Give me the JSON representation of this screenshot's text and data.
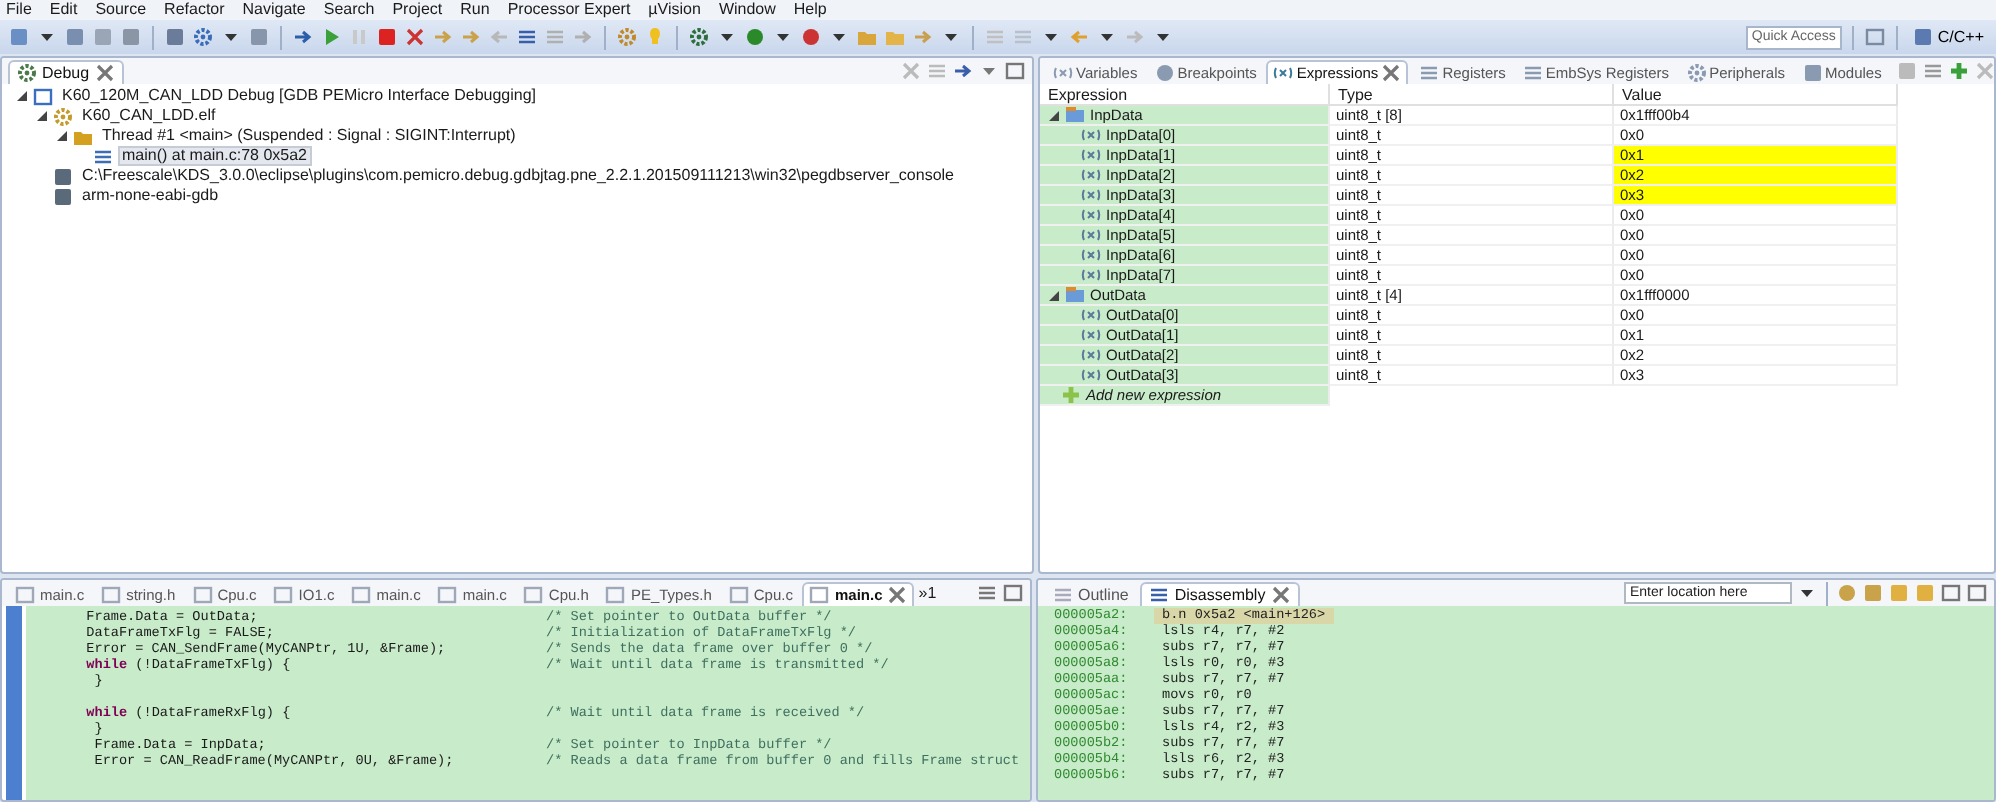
{
  "menu": [
    "File",
    "Edit",
    "Source",
    "Refactor",
    "Navigate",
    "Search",
    "Project",
    "Run",
    "Processor Expert",
    "µVision",
    "Window",
    "Help"
  ],
  "toolbar": {
    "quick_access": {
      "placeholder": "Quick Access"
    },
    "perspective": "C/C++"
  },
  "debug_view": {
    "tab": "Debug",
    "tree": [
      {
        "kind": "launch",
        "label": "K60_120M_CAN_LDD Debug [GDB PEMicro Interface Debugging]",
        "expanded": true,
        "selected": false,
        "children": [
          {
            "kind": "elf",
            "label": "K60_CAN_LDD.elf",
            "expanded": true,
            "selected": false,
            "children": [
              {
                "kind": "thread",
                "label": "Thread #1 <main> (Suspended : Signal : SIGINT:Interrupt)",
                "expanded": true,
                "selected": false,
                "children": [
                  {
                    "kind": "frame",
                    "label": "main() at main.c:78 0x5a2",
                    "selected": true
                  }
                ]
              }
            ]
          },
          {
            "kind": "process",
            "label": "C:\\Freescale\\KDS_3.0.0\\eclipse\\plugins\\com.pemicro.debug.gdbjtag.pne_2.2.1.201509111213\\win32\\pegdbserver_console",
            "selected": false
          },
          {
            "kind": "process",
            "label": "arm-none-eabi-gdb",
            "selected": false
          }
        ]
      }
    ]
  },
  "expressions_view": {
    "tabs": [
      {
        "label": "Variables",
        "selected": false
      },
      {
        "label": "Breakpoints",
        "selected": false
      },
      {
        "label": "Expressions",
        "selected": true
      },
      {
        "label": "Registers",
        "selected": false
      },
      {
        "label": "EmbSys Registers",
        "selected": false
      },
      {
        "label": "Peripherals",
        "selected": false
      },
      {
        "label": "Modules",
        "selected": false
      }
    ],
    "columns": [
      "Expression",
      "Type",
      "Value"
    ],
    "rows": [
      {
        "name": "InpData",
        "type": "uint8_t [8]",
        "value": "0x1fff00b4",
        "changed": false,
        "expanded": true,
        "children": [
          {
            "name": "InpData[0]",
            "type": "uint8_t",
            "value": "0x0",
            "changed": false
          },
          {
            "name": "InpData[1]",
            "type": "uint8_t",
            "value": "0x1",
            "changed": true
          },
          {
            "name": "InpData[2]",
            "type": "uint8_t",
            "value": "0x2",
            "changed": true
          },
          {
            "name": "InpData[3]",
            "type": "uint8_t",
            "value": "0x3",
            "changed": true
          },
          {
            "name": "InpData[4]",
            "type": "uint8_t",
            "value": "0x0",
            "changed": false
          },
          {
            "name": "InpData[5]",
            "type": "uint8_t",
            "value": "0x0",
            "changed": false
          },
          {
            "name": "InpData[6]",
            "type": "uint8_t",
            "value": "0x0",
            "changed": false
          },
          {
            "name": "InpData[7]",
            "type": "uint8_t",
            "value": "0x0",
            "changed": false
          }
        ]
      },
      {
        "name": "OutData",
        "type": "uint8_t [4]",
        "value": "0x1fff0000",
        "changed": false,
        "expanded": true,
        "children": [
          {
            "name": "OutData[0]",
            "type": "uint8_t",
            "value": "0x0",
            "changed": false
          },
          {
            "name": "OutData[1]",
            "type": "uint8_t",
            "value": "0x1",
            "changed": false
          },
          {
            "name": "OutData[2]",
            "type": "uint8_t",
            "value": "0x2",
            "changed": false
          },
          {
            "name": "OutData[3]",
            "type": "uint8_t",
            "value": "0x3",
            "changed": false
          }
        ]
      }
    ],
    "add_expression": "Add new expression"
  },
  "editor": {
    "tabs": [
      {
        "label": "main.c",
        "selected": false
      },
      {
        "label": "string.h",
        "selected": false
      },
      {
        "label": "Cpu.c",
        "selected": false
      },
      {
        "label": "IO1.c",
        "selected": false
      },
      {
        "label": "main.c",
        "selected": false
      },
      {
        "label": "main.c",
        "selected": false
      },
      {
        "label": "Cpu.h",
        "selected": false
      },
      {
        "label": "PE_Types.h",
        "selected": false
      },
      {
        "label": "Cpu.c",
        "selected": false
      },
      {
        "label": "main.c",
        "selected": true
      }
    ],
    "overflow": "»1",
    "lines": [
      {
        "kind": "code",
        "code": "  Frame.Data = OutData;",
        "comment": "/* Set pointer to OutData buffer */"
      },
      {
        "kind": "code",
        "code": "  DataFrameTxFlg = FALSE;",
        "comment": "/* Initialization of DataFrameTxFlg */"
      },
      {
        "kind": "code",
        "code": "  Error = CAN_SendFrame(MyCANPtr, 1U, &Frame);",
        "comment": "/* Sends the data frame over buffer 0 */"
      },
      {
        "kind": "code",
        "code": "  **while** (!DataFrameTxFlg) {",
        "comment": "/* Wait until data frame is transmitted */"
      },
      {
        "kind": "code",
        "code": "   }"
      },
      {
        "kind": "blank"
      },
      {
        "kind": "code",
        "code": "  **while** (!DataFrameRxFlg) {",
        "comment": "/* Wait until data frame is received */"
      },
      {
        "kind": "code",
        "code": "   }"
      },
      {
        "kind": "code",
        "code": "   Frame.Data = InpData;",
        "comment": "/* Set pointer to InpData buffer */"
      },
      {
        "kind": "code",
        "code": "   Error = CAN_ReadFrame(MyCANPtr, 0U, &Frame);",
        "comment": "/* Reads a data frame from buffer 0 and fills Frame struct"
      }
    ]
  },
  "disassembly": {
    "tabs": [
      {
        "label": "Outline",
        "selected": false
      },
      {
        "label": "Disassembly",
        "selected": true
      }
    ],
    "location": {
      "placeholder": "Enter location here"
    },
    "lines": [
      {
        "address": "000005a2:",
        "instruction": "b.n 0x5a2 <main+126>",
        "current": true
      },
      {
        "address": "000005a4:",
        "instruction": "lsls r4, r7, #2",
        "current": false
      },
      {
        "address": "000005a6:",
        "instruction": "subs r7, r7, #7",
        "current": false
      },
      {
        "address": "000005a8:",
        "instruction": "lsls r0, r0, #3",
        "current": false
      },
      {
        "address": "000005aa:",
        "instruction": "subs r7, r7, #7",
        "current": false
      },
      {
        "address": "000005ac:",
        "instruction": "movs r0, r0",
        "current": false
      },
      {
        "address": "000005ae:",
        "instruction": "subs r7, r7, #7",
        "current": false
      },
      {
        "address": "000005b0:",
        "instruction": "lsls r4, r2, #3",
        "current": false
      },
      {
        "address": "000005b2:",
        "instruction": "subs r7, r7, #7",
        "current": false
      },
      {
        "address": "000005b4:",
        "instruction": "lsls r6, r2, #3",
        "current": false
      },
      {
        "address": "000005b6:",
        "instruction": "subs r7, r7, #7",
        "current": false
      }
    ]
  }
}
